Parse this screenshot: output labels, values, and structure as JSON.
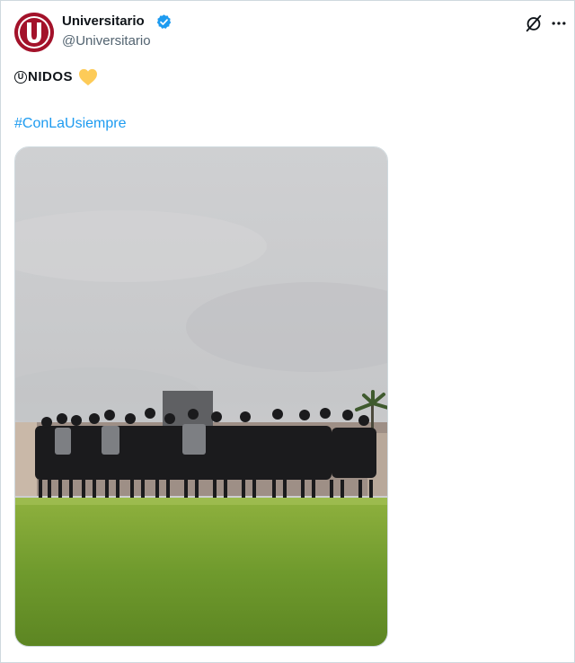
{
  "author": {
    "display_name": "Universitario",
    "handle": "@Universitario",
    "avatar_letter": "U",
    "avatar_color": "#a3122a",
    "verified_icon": "verified-badge-icon",
    "verified_color": "#1d9bf0"
  },
  "header": {
    "grok_icon": "grok-icon",
    "more_icon": "more-options-icon"
  },
  "tweet": {
    "circled_letter": "U",
    "text_rest": "NIDOS",
    "emoji": "yellow-heart",
    "hashtag": "#ConLaUsiempre",
    "hashtag_color": "#1d9bf0"
  },
  "media": {
    "description_icon": "team-huddle-photo"
  }
}
